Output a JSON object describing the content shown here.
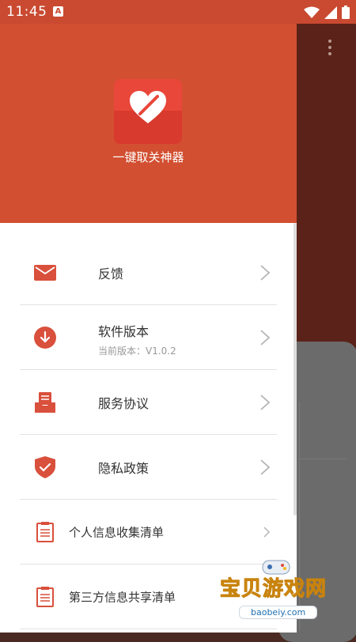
{
  "status_bar": {
    "time": "11:45",
    "badge": "A"
  },
  "drawer": {
    "app_name": "一键取关神器",
    "logo_icon": "heart-icon",
    "menu": [
      {
        "id": "feedback",
        "label": "反馈",
        "icon": "mail-icon"
      },
      {
        "id": "version",
        "label": "软件版本",
        "sublabel": "当前版本：V1.0.2",
        "icon": "download-icon"
      },
      {
        "id": "service",
        "label": "服务协议",
        "icon": "inbox-document-icon"
      },
      {
        "id": "privacy",
        "label": "隐私政策",
        "icon": "shield-check-icon"
      },
      {
        "id": "personal-info",
        "label": "个人信息收集清单",
        "icon": "list-document-icon"
      },
      {
        "id": "third-party",
        "label": "第三方信息共享清单",
        "icon": "list-document-icon"
      }
    ]
  },
  "watermark": {
    "text": "宝贝游戏网",
    "url": "baobeiy.com"
  },
  "colors": {
    "header": "#d24f31",
    "accent": "#d9503c",
    "status_bar": "#c94a30"
  }
}
